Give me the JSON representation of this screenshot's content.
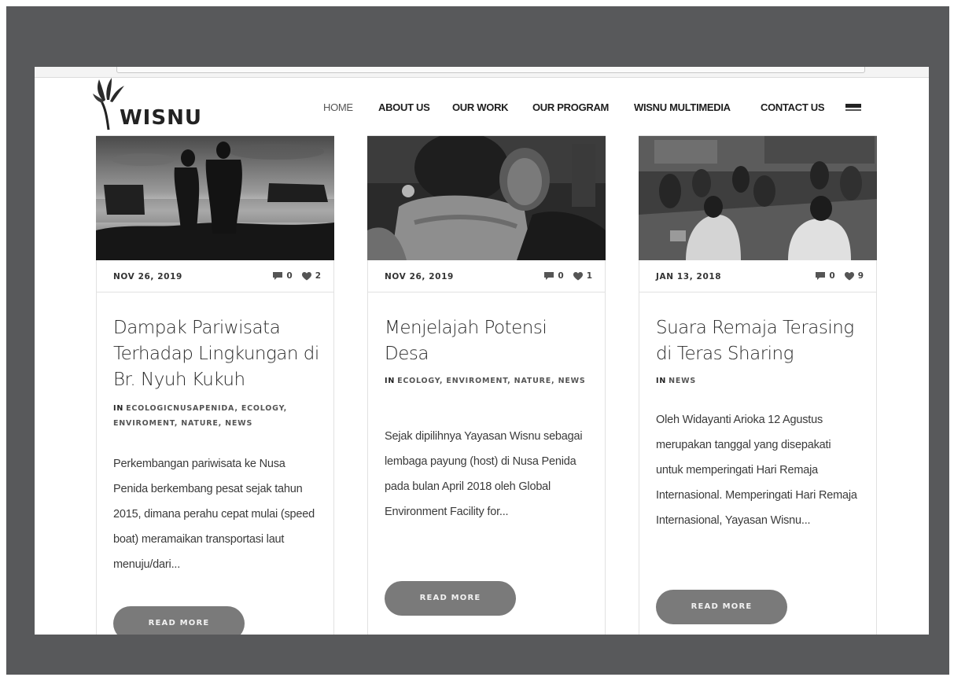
{
  "site": {
    "logo_text": "WISNU"
  },
  "nav": {
    "items": [
      {
        "label": "HOME"
      },
      {
        "label": "ABOUT US"
      },
      {
        "label": "OUR WORK"
      },
      {
        "label": "OUR PROGRAM"
      },
      {
        "label": "WISNU MULTIMEDIA"
      },
      {
        "label": "CONTACT US"
      }
    ]
  },
  "posts": [
    {
      "date": "NOV 26, 2019",
      "comments": "0",
      "likes": "2",
      "title": "Dampak Pariwisata Terhadap Lingkungan di Br. Nyuh Kukuh",
      "in_label": "IN",
      "categories": "ECOLOGICNUSAPENIDA, ECOLOGY, ENVIROMENT, NATURE, NEWS",
      "excerpt": "Perkembangan pariwisata ke Nusa Penida berkembang pesat sejak tahun 2015, dimana perahu cepat mulai (speed boat) meramaikan transportasi laut menuju/dari...",
      "read_more": "READ MORE"
    },
    {
      "date": "NOV 26, 2019",
      "comments": "0",
      "likes": "1",
      "title": "Menjelajah Potensi Desa",
      "in_label": "IN",
      "categories": "ECOLOGY, ENVIROMENT, NATURE, NEWS",
      "excerpt": "Sejak dipilihnya Yayasan Wisnu sebagai lembaga payung (host) di Nusa Penida pada bulan April 2018 oleh Global Environment Facility for...",
      "read_more": "READ MORE"
    },
    {
      "date": "JAN 13, 2018",
      "comments": "0",
      "likes": "9",
      "title": "Suara Remaja Terasing di Teras Sharing",
      "in_label": "IN",
      "categories": "NEWS",
      "excerpt": "Oleh Widayanti Arioka 12 Agustus merupakan tanggal yang disepakati untuk memperingati Hari Remaja Internasional. Memperingati Hari Remaja Internasional, Yayasan Wisnu...",
      "read_more": "READ MORE"
    }
  ],
  "icons": {
    "menu": "hamburger-menu-icon",
    "comment": "comment-icon",
    "like": "heart-icon"
  },
  "colors": {
    "frame": "#58595b",
    "button": "#7a7a7a",
    "text": "#2b2b2b"
  }
}
